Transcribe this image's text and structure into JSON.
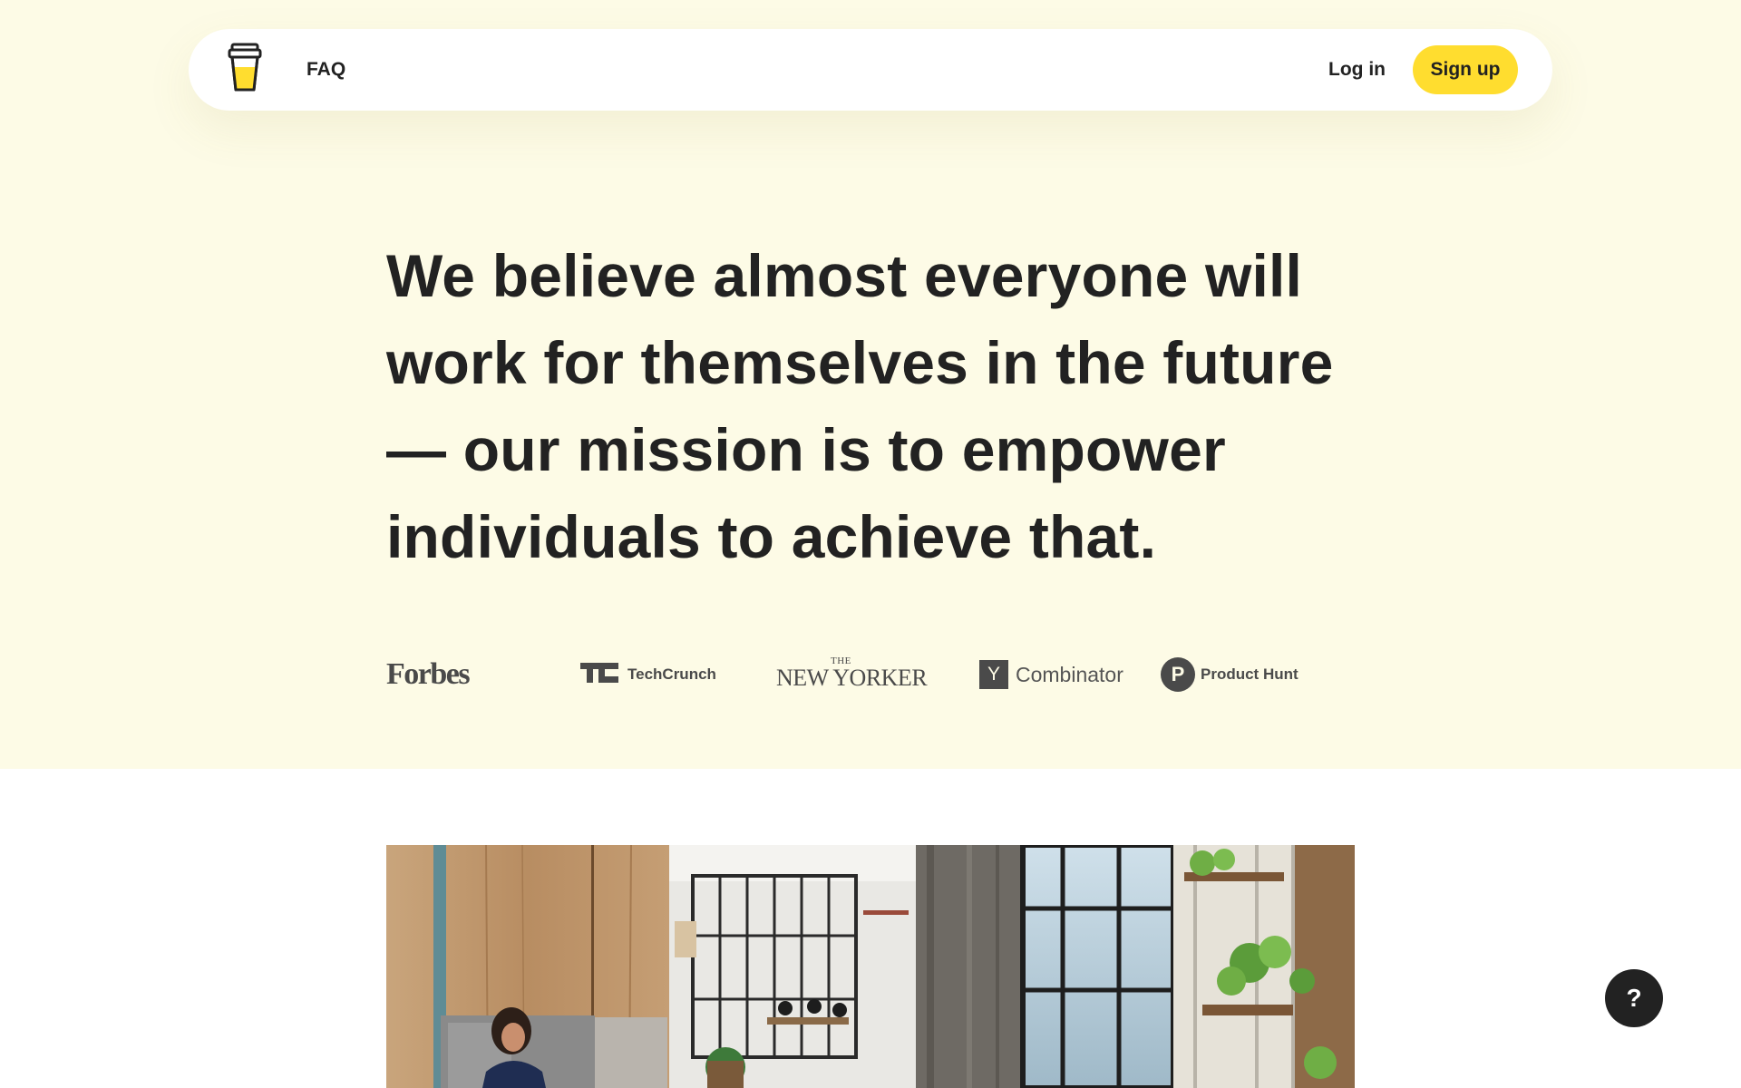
{
  "nav": {
    "logo_icon": "coffee-cup-icon",
    "faq_label": "FAQ",
    "login_label": "Log in",
    "signup_label": "Sign up"
  },
  "hero": {
    "mission_text": "We believe almost everyone will work for themselves in the future— our mission is to empower individuals to achieve that."
  },
  "press": {
    "forbes": "Forbes",
    "techcrunch_mark": "TC",
    "techcrunch": "TechCrunch",
    "newyorker_the": "THE",
    "newyorker": "NEW YORKER",
    "yc_mark": "Y",
    "yc": "Combinator",
    "ph_mark": "P",
    "ph": "Product Hunt"
  },
  "help": {
    "label": "?",
    "icon": "question-icon"
  },
  "colors": {
    "hero_bg": "#fdfbe6",
    "accent": "#ffdd2f",
    "text": "#222222"
  }
}
